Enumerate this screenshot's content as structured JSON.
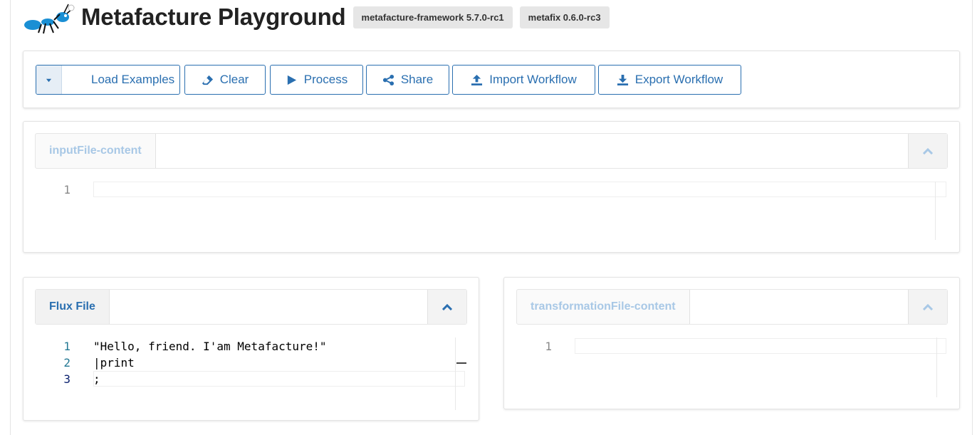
{
  "header": {
    "title": "Metafacture Playground",
    "badges": [
      "metafacture-framework 5.7.0-rc1",
      "metafix 0.6.0-rc3"
    ]
  },
  "toolbar": {
    "load_examples": "Load Examples",
    "clear": "Clear",
    "process": "Process",
    "share": "Share",
    "import_workflow": "Import Workflow",
    "export_workflow": "Export Workflow"
  },
  "input_panel": {
    "tab_label": "inputFile-content",
    "line_numbers": [
      "1"
    ]
  },
  "flux_panel": {
    "tab_label": "Flux File",
    "line_numbers": [
      "1",
      "2",
      "3"
    ],
    "lines": [
      "\"Hello, friend. I'am Metafacture!\"",
      "|print",
      ";"
    ]
  },
  "transformation_panel": {
    "tab_label": "transformationFile-content",
    "line_numbers": [
      "1"
    ]
  },
  "colors": {
    "accent": "#2a6fb0",
    "inactive_tab": "#a8c8e6",
    "line_number": "#237893"
  }
}
